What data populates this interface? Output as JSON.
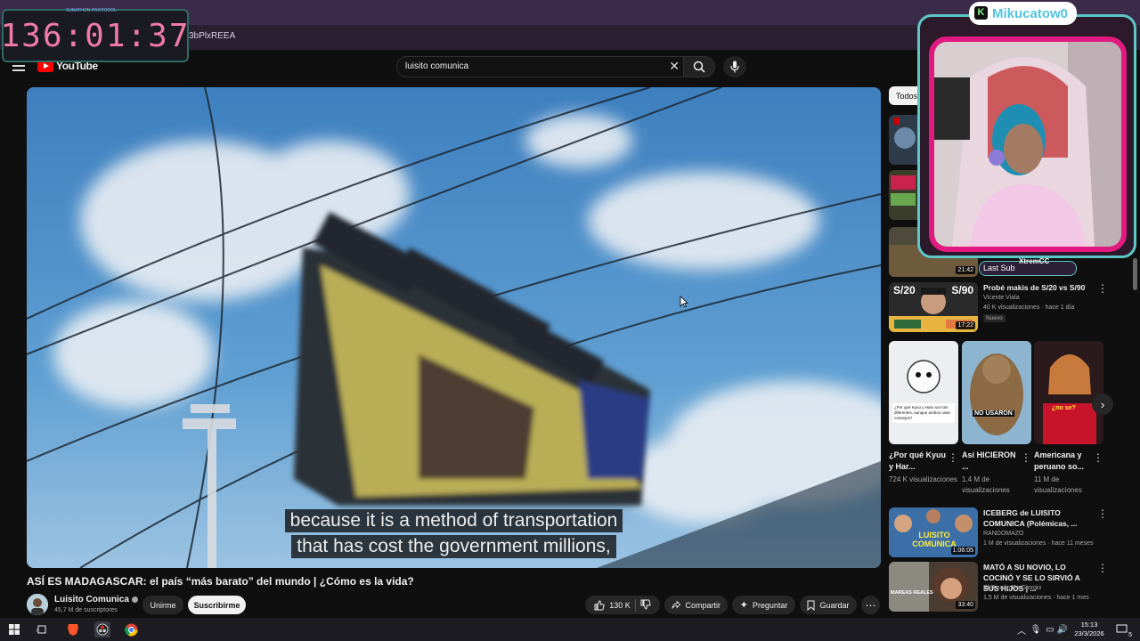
{
  "browser": {
    "url_fragment": "3bPlxREEA"
  },
  "timer": {
    "value": "136:01:37",
    "top_label": "SUBATHON PROTOCOL"
  },
  "header": {
    "logo_text": "YouTube",
    "search_value": "luisito comunica"
  },
  "video": {
    "subtitle_line1": "because it is a method of transportation",
    "subtitle_line2": "that has cost the government millions,",
    "title": "ASÍ ES MADAGASCAR: el país “más barato” del mundo | ¿Cómo es la vida?",
    "channel": "Luisito Comunica",
    "subscribers": "45,7 M de suscriptores",
    "join_label": "Unirme",
    "subscribe_label": "Suscribirme",
    "likes": "130 K",
    "share_label": "Compartir",
    "ask_label": "Preguntar",
    "save_label": "Guardar"
  },
  "filter_chip": "Todos",
  "recommendations": [
    {
      "title": "Probé makis de S/20 vs S/90",
      "channel": "Vicente Viala",
      "meta": "40 K visualizaciones · hace 1 día",
      "badge": "Nuevo",
      "duration": "17:22",
      "thumb_text_left": "S/20",
      "thumb_text_right": "S/90"
    },
    {
      "title": "ICEBERG de LUISITO COMUNICA (Polémicas, ...",
      "channel": "RANDOMAZO",
      "meta": "1 M de visualizaciones · hace 11 meses",
      "duration": "1:06:05",
      "thumb_text": "LUISITO COMUNICA"
    },
    {
      "title": "MATÓ A SU NOVIO, LO COCINÓ Y SE LO SIRVIÓ A SUS HIJOS | ...",
      "channel": "El Rincón De Giorgio",
      "meta": "1,5 M de visualizaciones · hace 1 mes",
      "duration": "33:40",
      "thumb_text": "MAREAS REALES"
    }
  ],
  "partial_durations": {
    "third": "21:42"
  },
  "shorts": [
    {
      "title": "¿Por qué Kyuu y Har...",
      "views": "724 K visualizaciones",
      "caption": "¿Por qué Kyuu y Haru son tan diferentes, aunque ambos usan consejos?"
    },
    {
      "title": "Así HICIERON ...",
      "views": "1,4 M de visualizaciones",
      "caption": "NO USARON"
    },
    {
      "title": "Americana y peruano so...",
      "views": "11 M de visualizaciones",
      "caption": "¿no se?"
    }
  ],
  "overlay": {
    "cam_name": "Mikucatow0",
    "last_sub_label": "Last Sub",
    "last_sub_value": "XtremCC"
  },
  "taskbar": {
    "time": "15:13",
    "date": "23/3/2026",
    "notif_count": "5"
  },
  "colors": {
    "youtube_red": "#ff0000",
    "cam_pink": "#e21a7f",
    "cam_teal": "#5ec6c7",
    "timer_text": "#f07aa8"
  }
}
